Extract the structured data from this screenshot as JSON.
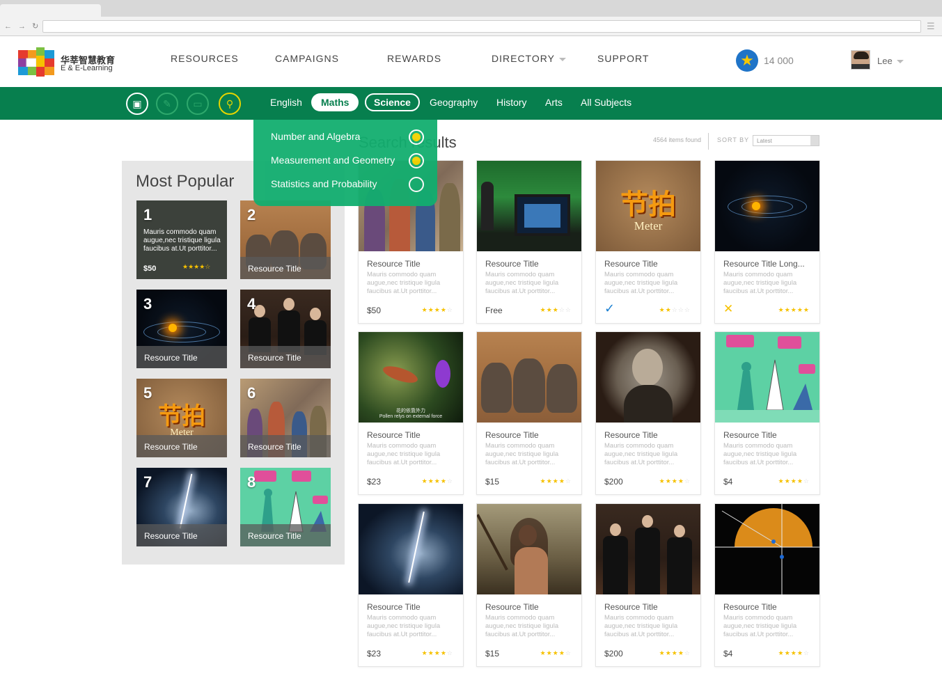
{
  "header": {
    "logo_cn": "华莘智慧教育",
    "logo_en": "E & E-Learning",
    "nav": [
      {
        "label": "RESOURCES"
      },
      {
        "label": "CAMPAIGNS"
      },
      {
        "label": "REWARDS"
      },
      {
        "label": "DIRECTORY"
      },
      {
        "label": "SUPPORT"
      }
    ],
    "points": "14 000",
    "user_name": "Lee"
  },
  "subject_bar": {
    "subjects": [
      "English",
      "Maths",
      "Science",
      "Geography",
      "History",
      "Arts",
      "All Subjects"
    ],
    "icons": [
      "book-icon",
      "pencil-icon",
      "tv-icon",
      "search-icon"
    ]
  },
  "maths_dropdown": {
    "items": [
      {
        "label": "Number and Algebra",
        "selected": true
      },
      {
        "label": "Measurement and Geometry",
        "selected": true
      },
      {
        "label": "Statistics and Probability",
        "selected": false
      }
    ]
  },
  "results": {
    "title": "Search results",
    "count": "4564 items found",
    "sort_label": "SORT BY",
    "sort_value": "Latest"
  },
  "popular": {
    "title": "Most Popular",
    "first": {
      "num": "1",
      "desc": "Mauris commodo quam augue,nec tristique ligula faucibus at.Ut porttitor...",
      "price": "$50",
      "stars": "★★★★☆"
    },
    "tiles": [
      {
        "num": "2",
        "label": "Resource Title"
      },
      {
        "num": "3",
        "label": "Resource Title"
      },
      {
        "num": "4",
        "label": "Resource Title"
      },
      {
        "num": "5",
        "label": "Resource Title"
      },
      {
        "num": "6",
        "label": "Resource Title"
      },
      {
        "num": "7",
        "label": "Resource Title"
      },
      {
        "num": "8",
        "label": "Resource Title"
      }
    ]
  },
  "meter_text": {
    "big": "节拍",
    "sub": "Meter"
  },
  "bird_caption": {
    "cn": "花的依靠外力",
    "en": "Pollen relys on external force"
  },
  "cards": [
    {
      "title": "Resource Title",
      "desc": "Mauris commodo quam augue,nec tristique ligula faucibus at.Ut porttitor...",
      "price": "$50",
      "rating": 4
    },
    {
      "title": "Resource Title",
      "desc": "Mauris commodo quam augue,nec tristique ligula faucibus at.Ut porttitor...",
      "price": "Free",
      "rating": 3
    },
    {
      "title": "Resource Title",
      "desc": "Mauris commodo quam augue,nec tristique ligula faucibus at.Ut porttitor...",
      "status": "check",
      "rating": 2
    },
    {
      "title": "Resource Title Long...",
      "desc": "Mauris commodo quam augue,nec tristique ligula faucibus at.Ut porttitor...",
      "status": "cross",
      "rating": 5
    },
    {
      "title": "Resource Title",
      "desc": "Mauris commodo quam augue,nec tristique ligula faucibus at.Ut porttitor...",
      "price": "$23",
      "rating": 4
    },
    {
      "title": "Resource Title",
      "desc": "Mauris commodo quam augue,nec tristique ligula faucibus at.Ut porttitor...",
      "price": "$15",
      "rating": 4
    },
    {
      "title": "Resource Title",
      "desc": "Mauris commodo quam augue,nec tristique ligula faucibus at.Ut porttitor...",
      "price": "$200",
      "rating": 4
    },
    {
      "title": "Resource Title",
      "desc": "Mauris commodo quam augue,nec tristique ligula faucibus at.Ut porttitor...",
      "price": "$4",
      "rating": 4
    },
    {
      "title": "Resource Title",
      "desc": "Mauris commodo quam augue,nec tristique ligula faucibus at.Ut porttitor...",
      "price": "$23",
      "rating": 4
    },
    {
      "title": "Resource Title",
      "desc": "Mauris commodo quam augue,nec tristique ligula faucibus at.Ut porttitor...",
      "price": "$15",
      "rating": 4
    },
    {
      "title": "Resource Title",
      "desc": "Mauris commodo quam augue,nec tristique ligula faucibus at.Ut porttitor...",
      "price": "$200",
      "rating": 4
    },
    {
      "title": "Resource Title",
      "desc": "Mauris commodo quam augue,nec tristique ligula faucibus at.Ut porttitor...",
      "price": "$4",
      "rating": 4
    }
  ],
  "colors": {
    "brand_green": "#077f4e",
    "dropdown_green": "#12ae6f",
    "star": "#f6c100",
    "check_blue": "#1a7fd1"
  }
}
